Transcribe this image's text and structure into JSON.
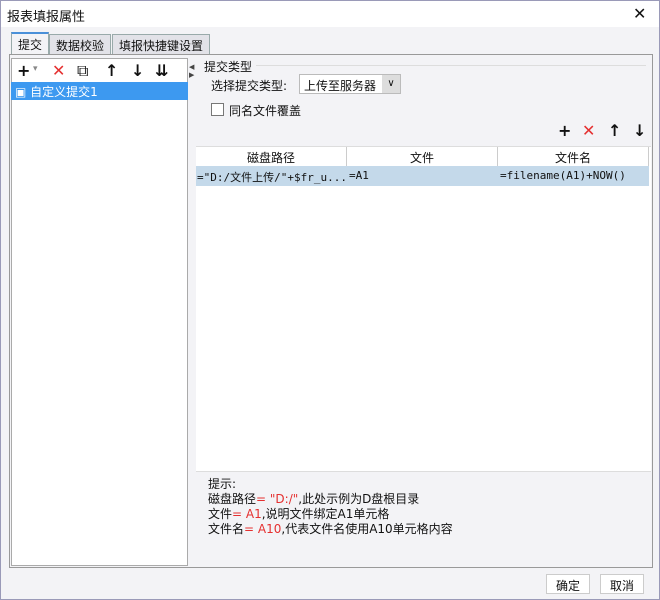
{
  "window": {
    "title": "报表填报属性",
    "close": "✕"
  },
  "tabs": [
    {
      "label": "提交"
    },
    {
      "label": "数据校验"
    },
    {
      "label": "填报快捷键设置"
    }
  ],
  "left_toolbar": {
    "add": "+",
    "add_arrow": "▾",
    "delete": "✕",
    "copy": "⧉",
    "up": "↑",
    "down": "↓",
    "bottom": "⇊"
  },
  "list": {
    "items": [
      {
        "label": "自定义提交1"
      }
    ]
  },
  "submit": {
    "group_label": "提交类型",
    "type_label": "选择提交类型:",
    "type_value": "上传至服务器",
    "overwrite_label": "同名文件覆盖"
  },
  "right_toolbar": {
    "add": "+",
    "delete": "✕",
    "up": "↑",
    "down": "↓"
  },
  "table": {
    "headers": [
      "磁盘路径",
      "文件",
      "文件名"
    ],
    "rows": [
      [
        "=\"D:/文件上传/\"+$fr_u...",
        "=A1",
        "=filename(A1)+NOW()"
      ]
    ]
  },
  "hint": {
    "title": "提示:",
    "l1": {
      "a": "磁盘路径",
      "b": "= \"D:/\"",
      "c": ",此处示例为D盘根目录"
    },
    "l2": {
      "a": "文件",
      "b": "= A1",
      "c": ",说明文件绑定A1单元格"
    },
    "l3": {
      "a": "文件名",
      "b": "= A10",
      "c": ",代表文件名使用A10单元格内容"
    }
  },
  "buttons": {
    "ok": "确定",
    "cancel": "取消"
  },
  "colors": {
    "selection": "#3d99f0",
    "row": "#c4d9ea",
    "accent_red": "#e53030"
  }
}
